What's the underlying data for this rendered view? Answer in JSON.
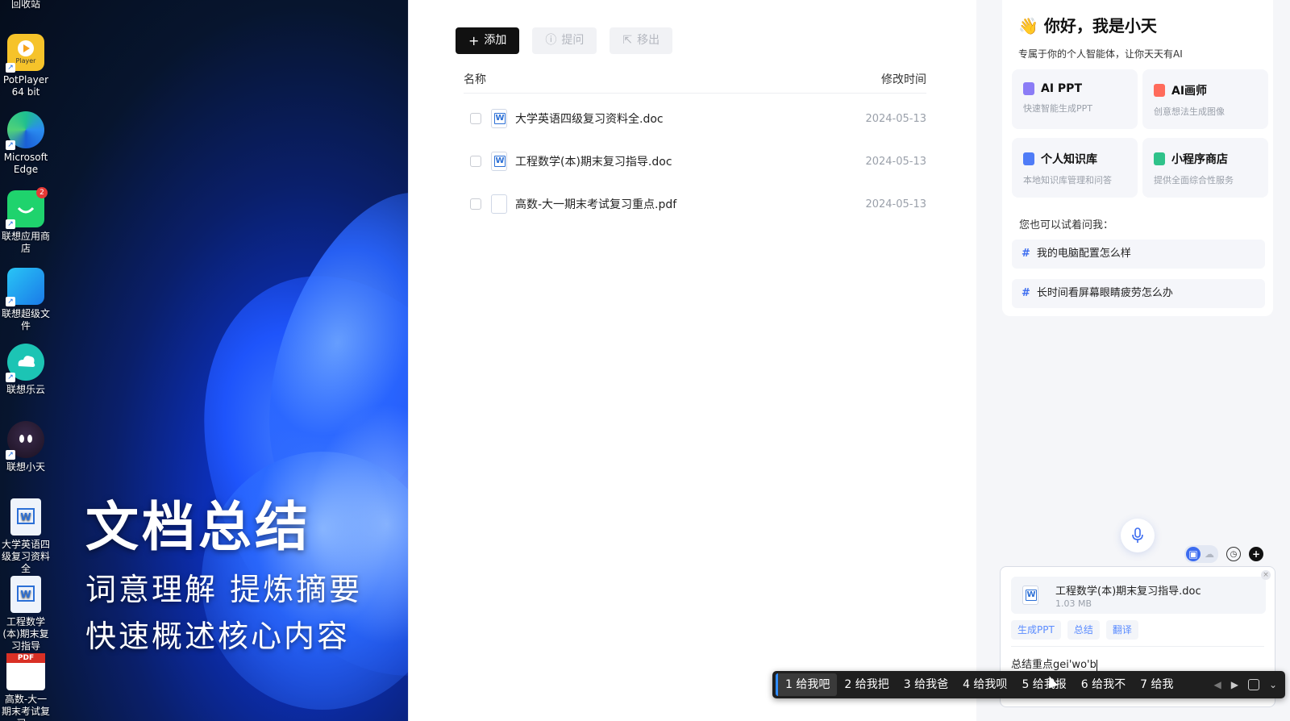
{
  "desktop": {
    "icons": [
      {
        "label": "回收站"
      },
      {
        "label": "PotPlayer 64 bit",
        "icon_text": "Player"
      },
      {
        "label": "Microsoft Edge"
      },
      {
        "label": "联想应用商店",
        "badge": "2"
      },
      {
        "label": "联想超级文件"
      },
      {
        "label": "联想乐云"
      },
      {
        "label": "联想小天"
      },
      {
        "label": "大学英语四级复习资料全"
      },
      {
        "label": "工程数学(本)期末复习指导"
      },
      {
        "label": "高数-大一期末考试复习...",
        "icon_text": "PDF"
      }
    ],
    "promo": {
      "title": "文档总结",
      "line1": "词意理解 提炼摘要",
      "line2": "快速概述核心内容"
    }
  },
  "files": {
    "toolbar": {
      "add": "添加",
      "ask": "提问",
      "remove": "移出"
    },
    "columns": {
      "name": "名称",
      "modified": "修改时间"
    },
    "rows": [
      {
        "name": "大学英语四级复习资料全.doc",
        "date": "2024-05-13",
        "type": "word"
      },
      {
        "name": "工程数学(本)期末复习指导.doc",
        "date": "2024-05-13",
        "type": "word"
      },
      {
        "name": "高数-大一期末考试复习重点.pdf",
        "date": "2024-05-13",
        "type": "pdf"
      }
    ]
  },
  "assistant": {
    "greeting": "你好，我是小天",
    "greeting_emoji": "👋",
    "subtitle": "专属于你的个人智能体，让你天天有AI",
    "features": [
      {
        "title": "AI PPT",
        "desc": "快速智能生成PPT",
        "color": "#8b7cf6"
      },
      {
        "title": "AI画师",
        "desc": "创意想法生成图像",
        "color": "#ff6b5b"
      },
      {
        "title": "个人知识库",
        "desc": "本地知识库管理和问答",
        "color": "#4f7cf7"
      },
      {
        "title": "小程序商店",
        "desc": "提供全面综合性服务",
        "color": "#2fc28a"
      }
    ],
    "try_label": "您也可以试着问我：",
    "suggestions": [
      "我的电脑配置怎么样",
      "长时间看屏幕眼睛疲劳怎么办"
    ],
    "attachment": {
      "name": "工程数学(本)期末复习指导.doc",
      "size": "1.03 MB"
    },
    "actions": [
      "生成PPT",
      "总结",
      "翻译"
    ],
    "input_text": "总结重点gei'wo'b"
  },
  "ime": {
    "candidates": [
      "1 给我吧",
      "2 给我把",
      "3 给我爸",
      "4 给我呗",
      "5 给我报",
      "6 给我不",
      "7 给我"
    ]
  }
}
